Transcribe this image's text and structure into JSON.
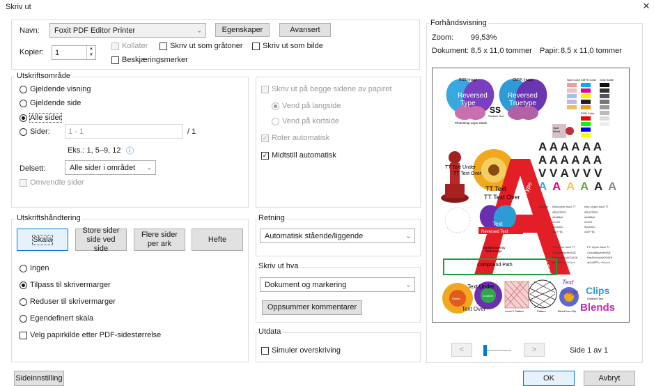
{
  "window": {
    "title": "Skriv ut",
    "close_glyph": "✕"
  },
  "printer": {
    "name_label": "Navn:",
    "name_value": "Foxit PDF Editor Printer",
    "properties_button": "Egenskaper",
    "advanced_button": "Avansert",
    "copies_label": "Kopier:",
    "copies_value": "1",
    "collate_label": "Kollater",
    "grayscale_label": "Skriv ut som gråtoner",
    "as_image_label": "Skriv ut som bilde",
    "crop_marks_label": "Beskjæringsmerker"
  },
  "print_range": {
    "title": "Utskriftsområde",
    "current_view": "Gjeldende visning",
    "current_page": "Gjeldende side",
    "all_pages": "Alle sider",
    "pages_label": "Sider:",
    "pages_value": "1 - 1",
    "pages_total": "/ 1",
    "example": "Eks.: 1, 5–9, 12",
    "info_glyph": "ⓘ",
    "subset_label": "Delsett:",
    "subset_value": "Alle sider i området",
    "reverse_label": "Omvendte sider"
  },
  "duplex": {
    "both_sides": "Skriv ut på begge sidene av papiret",
    "flip_long": "Vend på langside",
    "flip_short": "Vend på kortside",
    "auto_rotate": "Roter automatisk",
    "auto_center": "Midtstill automatisk"
  },
  "handling": {
    "title": "Utskriftshåndtering",
    "tabs": [
      "Skala",
      "Store sider\nside ved side",
      "Flere sider\nper ark",
      "Hefte"
    ],
    "none": "Ingen",
    "fit": "Tilpass til skrivermarger",
    "shrink": "Reduser til skrivermarger",
    "custom": "Egendefinert skala",
    "paper_source": "Velg papirkilde etter PDF-sidestørrelse"
  },
  "orientation": {
    "title": "Retning",
    "value": "Automatisk stående/liggende"
  },
  "print_what": {
    "title": "Skriv ut hva",
    "value": "Dokument og markering",
    "summarize_button": "Oppsummer kommentarer"
  },
  "output": {
    "title": "Utdata",
    "simulate_overprint": "Simuler overskriving"
  },
  "preview": {
    "title": "Forhåndsvisning",
    "zoom_label": "Zoom:",
    "zoom_value": "99,53%",
    "document_label": "Dokument:",
    "document_value": "8,5 x 11,0 tommer",
    "paper_label": "Papir:",
    "paper_value": "8,5 x 11,0 tommer",
    "prev_glyph": "<",
    "next_glyph": ">",
    "page_indicator": "Side 1 av 1",
    "content": {
      "rgb_image": "RGB Image",
      "cmyk_image": "CMYK Image",
      "reversed_type": "Reversed\nType",
      "reversed_truetype": "Reversed\nTruetype",
      "ps_layer_mask": "Photoshop Layer Mask",
      "ss": "SS",
      "stroked_text": "Stroked Text",
      "spot_color": "Spot Color",
      "cmyk_color": "CMYK Color",
      "gray_scale": "Gray Scale",
      "rgb_color": "RGB Color",
      "spot_blend": "Spot\nBlend",
      "reversed_text": "Reversed Text",
      "angled_type": "Angled Type",
      "angled_truetype": "Angled Truetype",
      "tt_text_under": "TT Text Under",
      "tt_text_over": "TT Text Over",
      "tt_text": "TT Text",
      "masked_overlay": "Masked Overlay\nRGB Image",
      "compound_path": "Compound Path",
      "text_big": "Text",
      "image_word": "Image",
      "clips_word": "Clips",
      "blends_word": "Blends",
      "outlined_text": "Outlined Text",
      "radial": "Radial",
      "gradient": "Gradient",
      "level2_pattern": "Level 2 Pattern",
      "pattern": "Pattern",
      "blend_clip": "Blend thru Clip",
      "text_over": "Text Over",
      "text_under": "Text Under",
      "ligature": "Ligature",
      "mac_upper_ascii": "MacUpper Ascii TT",
      "mac_upper_ascii2": "Mac Upper Ascii TT",
      "pc_upper_ascii_tt": "PC Upper Ascii TT",
      "pc_upper_ascii_t1": "PC Upper Ascii T1"
    }
  },
  "footer": {
    "page_setup": "Sideinnstilling",
    "ok": "OK",
    "cancel": "Avbryt"
  },
  "colors": {
    "accent": "#0078d7",
    "accent_bg": "#e5f1fb",
    "button_bg": "#e1e1e1",
    "border": "#adadad",
    "green_box": "#1a9c3a",
    "red_a": "#e41e26"
  }
}
